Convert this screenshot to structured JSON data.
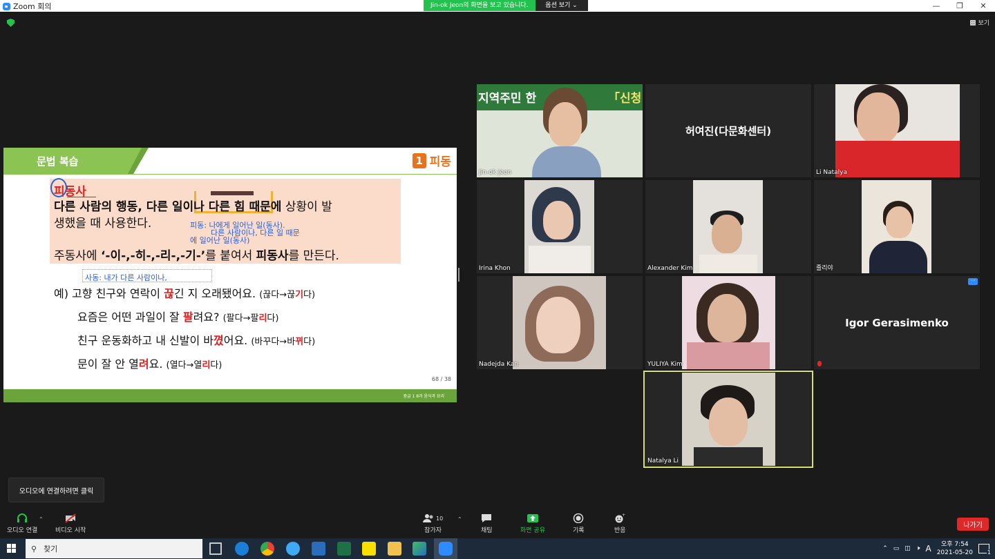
{
  "window": {
    "title": "Zoom 회의",
    "minimize": "—",
    "maximize": "❐",
    "close": "✕"
  },
  "share_banner": {
    "message": "Jin-ok  Jeon의 화면을 보고 있습니다.",
    "options": "옵션 보기 ⌄"
  },
  "view_button": {
    "label": "보기"
  },
  "slide": {
    "section_title": "문법 복습",
    "badge_num": "1",
    "badge_label": "피동",
    "term": "피동사",
    "definition_line1_bold": "다른 사람의 행동, 다른 일이나 다른 힘 때문에",
    "definition_line1_rest": " 상황이 발",
    "definition_line2": "생했을 때 사용한다.",
    "definition_line3_pre": "주동사에 ",
    "definition_line3_bold": "‘-이-,-히-,-리-,-기-’",
    "definition_line3_mid": "를 붙여서 ",
    "definition_line3_bold2": "피동사",
    "definition_line3_post": "를 만든다.",
    "annotation1": "피동: 나에게 일어난 일(동사).",
    "annotation2": "다른 사람이나, 다른 일 때문",
    "annotation3": "에 일어난 일(동사)",
    "annotation4": "사동: 내가 다른 사람이나,",
    "examples": [
      {
        "pre": "예) 고향 친구와 연락이 ",
        "hl": "끊",
        "post": "긴 지 오래됐어요. ",
        "note_pre": "(끊다→끊",
        "note_hl": "기",
        "note_post": "다)"
      },
      {
        "pre": "요즘은 어떤 과일이 잘 ",
        "hl": "팔",
        "post": "려요? ",
        "note_pre": "(팔다→팔",
        "note_hl": "리",
        "note_post": "다)"
      },
      {
        "pre": "친구 운동화하고 내 신발이 바",
        "hl": "꼈",
        "post": "어요. ",
        "note_pre": "(바꾸다→바",
        "note_hl": "뀌",
        "note_post": "다)"
      },
      {
        "pre": "문이 잘 안 열",
        "hl": "려",
        "post": "요. ",
        "note_pre": "(열다→열",
        "note_hl": "리",
        "note_post": "다)"
      }
    ],
    "page_number": "68  / 38",
    "footer_text": "중급 1  8과 음식과 요리"
  },
  "participants": [
    {
      "name": "Jin-ok Jeon"
    },
    {
      "name": "허여진(다문화센터)"
    },
    {
      "name": "Li Natalya"
    },
    {
      "name": "Irina Khon"
    },
    {
      "name": "Alexander Kim"
    },
    {
      "name": "줄리야"
    },
    {
      "name": "Nadejda Kan"
    },
    {
      "name": "YULIYA Kim"
    },
    {
      "name": "Igor Gerasimenko"
    },
    {
      "name": "Natalya Li"
    }
  ],
  "tile_banner_text": "지역주민 한",
  "tile_banner_text2": "「신청",
  "tooltip": "오디오에 연결하려면 클릭",
  "toolbar": {
    "audio": "오디오 연결",
    "video": "비디오 시작",
    "participants": "참가자",
    "participants_count": "10",
    "chat": "채팅",
    "share": "화면 공유",
    "record": "기록",
    "reactions": "반응",
    "leave": "나가기"
  },
  "taskbar": {
    "search": "찾기",
    "time": "오후 7:54",
    "date": "2021-05-20",
    "ime": "A",
    "notif_count": "1"
  },
  "colors": {
    "accent_green": "#23c24f",
    "slide_green": "#6aa43a",
    "highlight_red": "#e02020",
    "leave_red": "#e02828",
    "active_speaker": "#d8e26a"
  }
}
